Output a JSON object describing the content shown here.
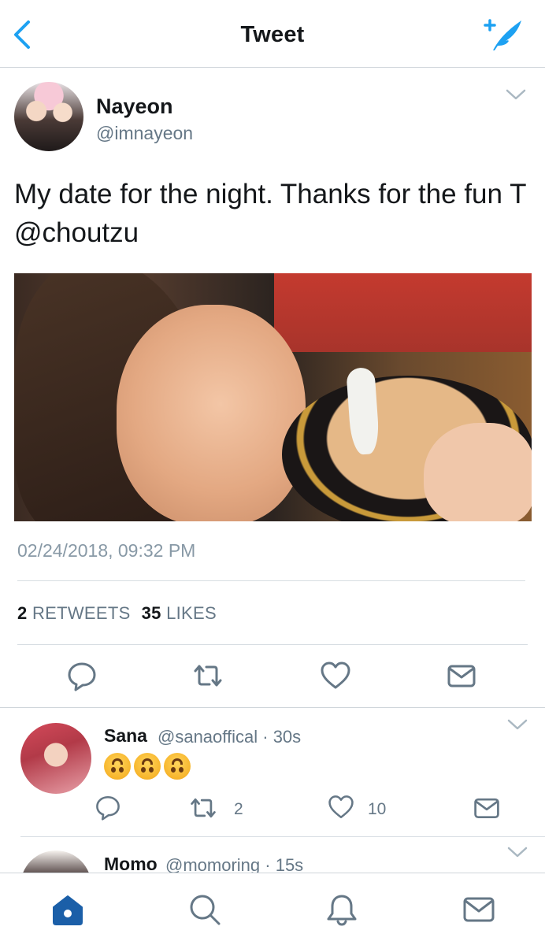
{
  "header": {
    "title": "Tweet",
    "back_icon": "chevron-left-icon",
    "compose_icon": "compose-tweet-icon"
  },
  "tweet": {
    "author_name": "Nayeon",
    "author_handle": "@imnayeon",
    "text": "My date for the night. Thanks for the fun T @choutzu",
    "timestamp": "02/24/2018, 09:32 PM",
    "retweets_count": "2",
    "retweets_label": "RETWEETS",
    "likes_count": "35",
    "likes_label": "LIKES",
    "actions": [
      "reply-icon",
      "retweet-icon",
      "like-icon",
      "direct-message-icon"
    ]
  },
  "replies": [
    {
      "name": "Sana",
      "handle": "@sanaoffical",
      "time": "30s",
      "content_emojis": [
        "upside-down-face",
        "upside-down-face",
        "upside-down-face"
      ],
      "retweet_count": "2",
      "like_count": "10"
    },
    {
      "name": "Momo",
      "handle": "@momoring",
      "time": "15s"
    }
  ],
  "tabbar": {
    "items": [
      "home-icon",
      "search-icon",
      "notifications-icon",
      "messages-icon"
    ],
    "active": "home-icon"
  },
  "colors": {
    "accent": "#1da1f2",
    "active_tab": "#1b5fa8",
    "icon_gray": "#657786",
    "text_secondary": "#8899a6"
  }
}
